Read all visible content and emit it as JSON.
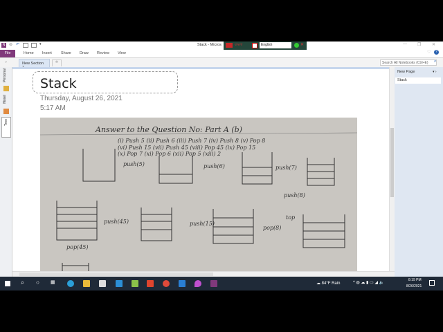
{
  "window": {
    "title": "Stack - Micros",
    "ime_language": "English",
    "ime_label": "বাংলা"
  },
  "ribbon": {
    "file": "File",
    "tabs": [
      "Home",
      "Insert",
      "Share",
      "Draw",
      "Review",
      "View"
    ]
  },
  "section_tab": "New Section 1",
  "search_placeholder": "Search All Notebooks (Ctrl+E)",
  "notebooks": [
    "Personal",
    "Nosel",
    "Tree"
  ],
  "page": {
    "title": "Stack",
    "date": "Thursday, August 26, 2021",
    "time": "5:17 AM"
  },
  "pages_panel": {
    "new_page": "New Page",
    "pages": [
      "Stack"
    ]
  },
  "photo": {
    "heading": "Answer to the Question No: Part A (b)",
    "lines": [
      "(i) Push 5  (ii) Push 6  (iii) Push 7  (iv) Push 8  (v) Pop 8",
      "(vi) Push 15  (vii) Push 45  (viii) Pop 45  (ix) Pop 15",
      "(x) Pop 7  (xi) Pop 6  (xii) Pop 5  (xiii) 2"
    ],
    "ops": [
      "push(5)",
      "push(6)",
      "push(7)",
      "push(8)",
      "push(45)",
      "push(15)",
      "pop(8)",
      "pop(45)",
      "top"
    ]
  },
  "taskbar": {
    "weather": "84°F  Rain",
    "time": "8:19 PM",
    "date": "8/26/2021"
  }
}
